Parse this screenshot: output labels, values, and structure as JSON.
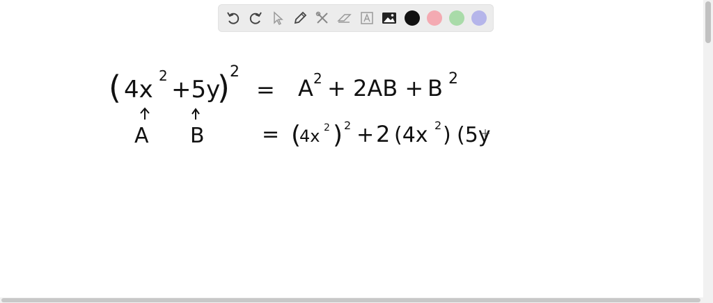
{
  "toolbar": {
    "tools": [
      "undo-icon",
      "redo-icon",
      "select-pointer-icon",
      "pen-icon",
      "tools-icon",
      "eraser-icon",
      "text-box-icon",
      "image-icon"
    ],
    "colors": [
      "#111111",
      "#f4aab2",
      "#a9dba9",
      "#b5b5ea"
    ],
    "active_color": "#111111"
  },
  "math": {
    "line1": {
      "lhs_open": "(",
      "lhs_body": "4x",
      "lhs_exp_inner": "2",
      "lhs_plus": "+5y",
      "lhs_close": ")",
      "lhs_exp": "2",
      "eq": "=",
      "rhs_a": "A",
      "rhs_a_exp": "2",
      "rhs_mid": "+ 2AB +",
      "rhs_b": "B",
      "rhs_b_exp": "2"
    },
    "arrows": {
      "a_label": "A",
      "b_label": "B"
    },
    "line2": {
      "eq": "=",
      "t1_open": "(",
      "t1_body": "4x",
      "t1_exp_inner": "2",
      "t1_close": ")",
      "t1_exp": "2",
      "plus": "+",
      "coef": "2",
      "t2": "(4x",
      "t2_exp": "2",
      "t2_close": ")",
      "t3": "(5y"
    }
  }
}
